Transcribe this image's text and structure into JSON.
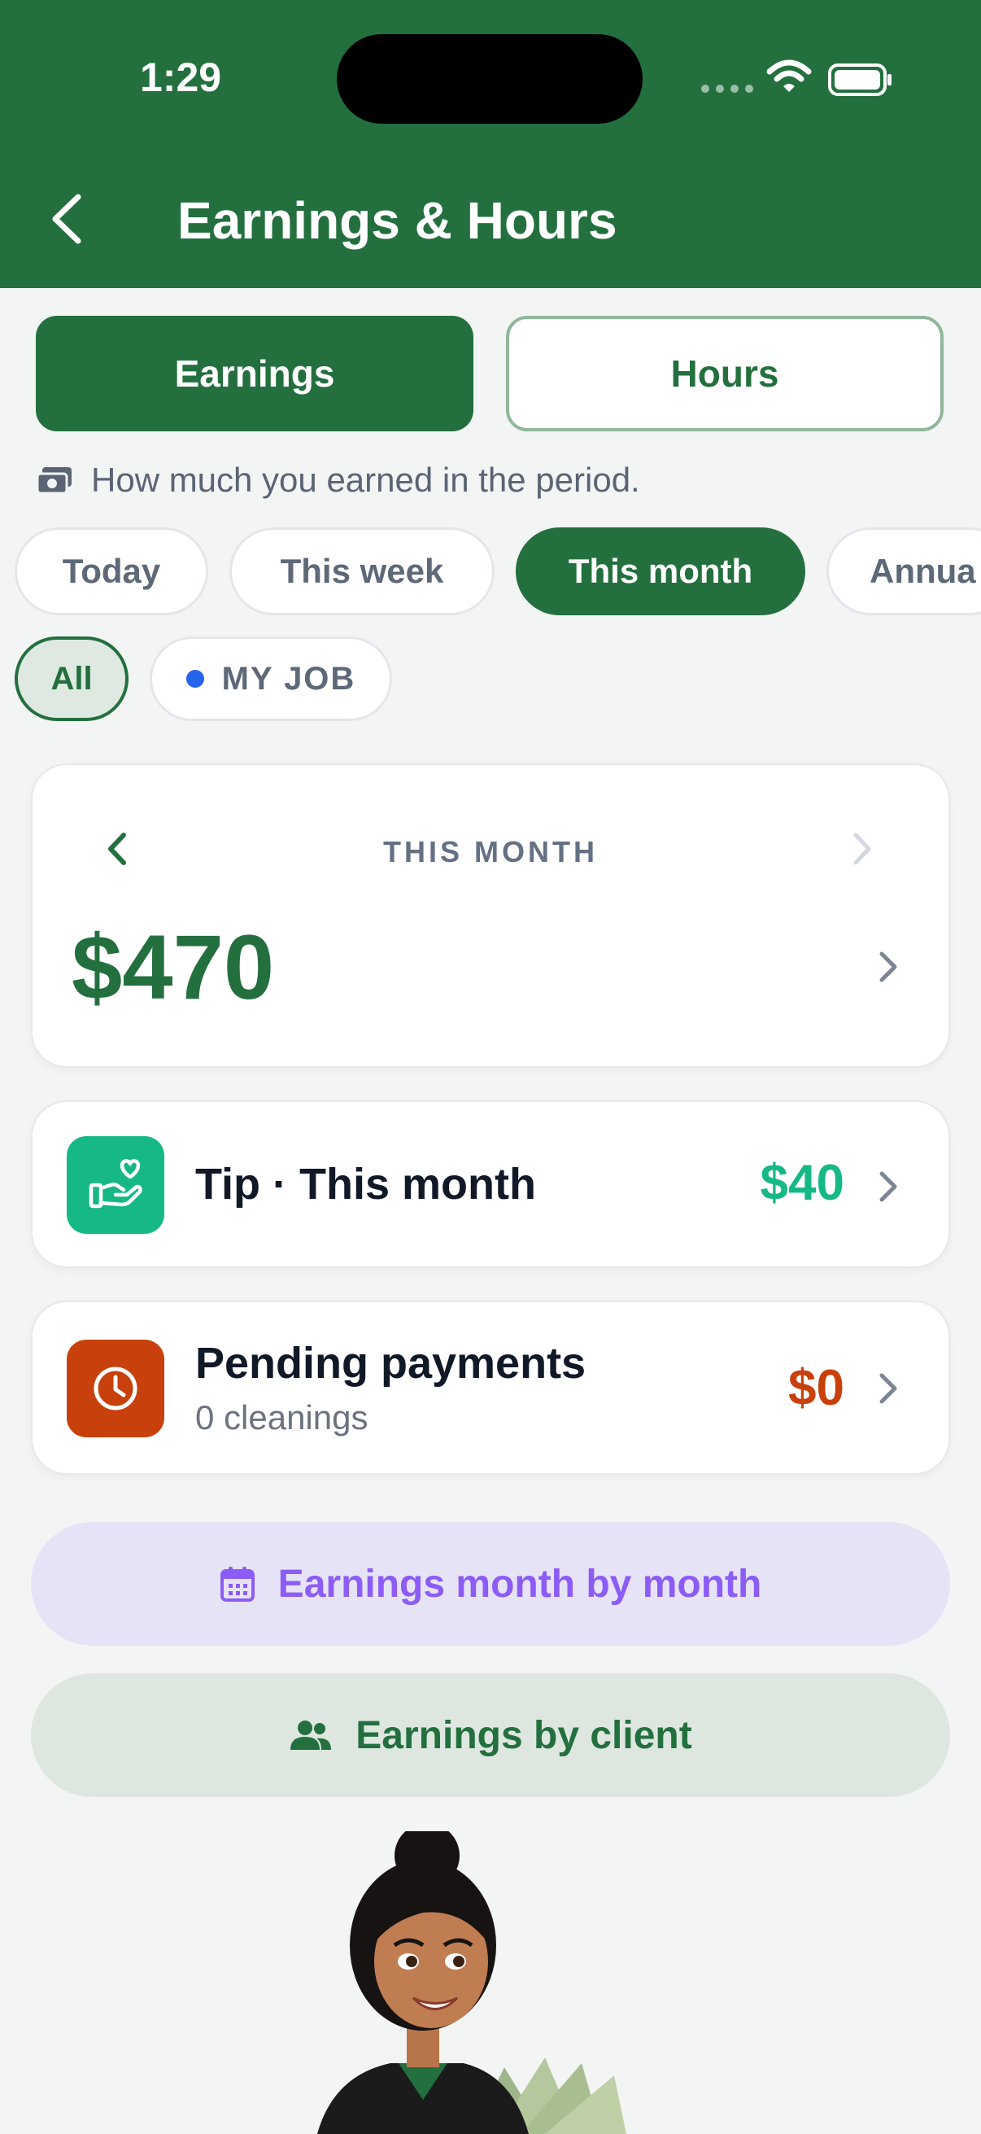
{
  "status_bar": {
    "time": "1:29"
  },
  "header": {
    "title": "Earnings & Hours"
  },
  "segments": {
    "earnings": "Earnings",
    "hours": "Hours"
  },
  "hint": "How much you earned in the period.",
  "periods": [
    "Today",
    "This week",
    "This month",
    "Annua"
  ],
  "active_period": "This month",
  "filters": {
    "all": "All",
    "job": "MY JOB"
  },
  "month_card": {
    "label": "THIS MONTH",
    "amount": "$470"
  },
  "tip": {
    "title": "Tip · This month",
    "amount": "$40"
  },
  "pending": {
    "title": "Pending payments",
    "subtitle": "0 cleanings",
    "amount": "$0"
  },
  "buttons": {
    "by_month": "Earnings month by month",
    "by_client": "Earnings by client"
  },
  "colors": {
    "brand_green": "#23703e",
    "tip_green": "#16b886",
    "pending_orange": "#c8410c",
    "purple": "#8b5cf6",
    "job_dot_blue": "#2563eb"
  }
}
